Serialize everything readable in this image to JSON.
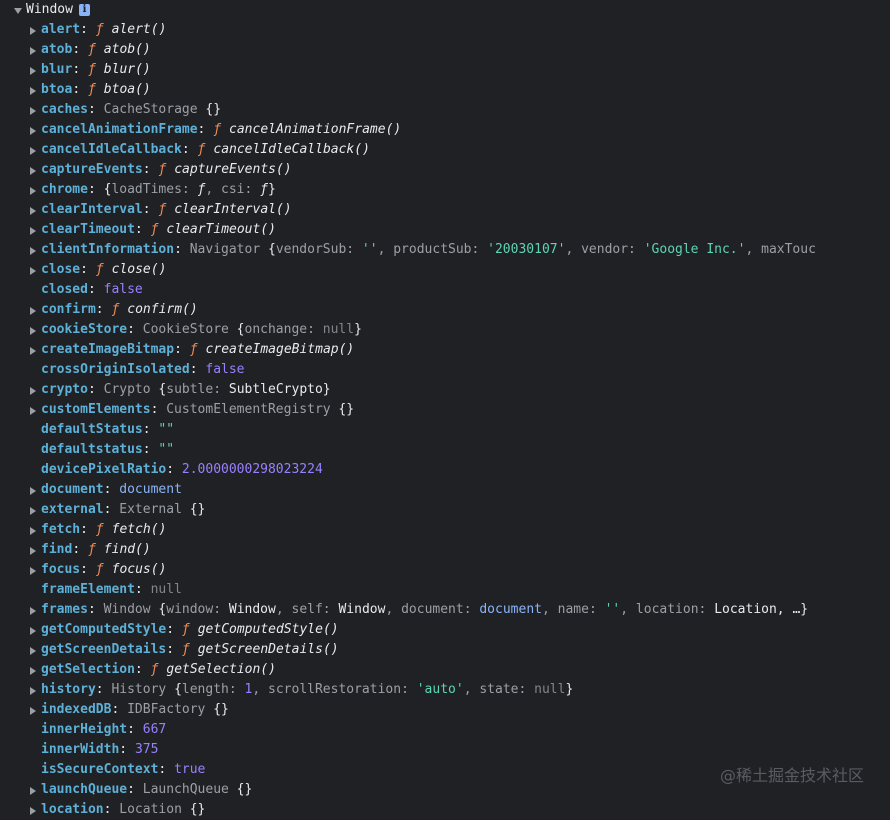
{
  "root": {
    "label": "Window",
    "info_icon": "info-icon"
  },
  "watermark": "@稀土掘金技术社区",
  "rows": [
    {
      "key": "alert",
      "expandable": true,
      "parts": [
        [
          "f",
          "ƒ"
        ],
        [
          "fn",
          "alert()"
        ]
      ]
    },
    {
      "key": "atob",
      "expandable": true,
      "parts": [
        [
          "f",
          "ƒ"
        ],
        [
          "fn",
          "atob()"
        ]
      ]
    },
    {
      "key": "blur",
      "expandable": true,
      "parts": [
        [
          "f",
          "ƒ"
        ],
        [
          "fn",
          "blur()"
        ]
      ]
    },
    {
      "key": "btoa",
      "expandable": true,
      "parts": [
        [
          "f",
          "ƒ"
        ],
        [
          "fn",
          "btoa()"
        ]
      ]
    },
    {
      "key": "caches",
      "expandable": true,
      "parts": [
        [
          "obj",
          "CacheStorage "
        ],
        [
          "plain",
          "{}"
        ]
      ]
    },
    {
      "key": "cancelAnimationFrame",
      "expandable": true,
      "parts": [
        [
          "f",
          "ƒ"
        ],
        [
          "fn",
          "cancelAnimationFrame()"
        ]
      ]
    },
    {
      "key": "cancelIdleCallback",
      "expandable": true,
      "parts": [
        [
          "f",
          "ƒ"
        ],
        [
          "fn",
          "cancelIdleCallback()"
        ]
      ]
    },
    {
      "key": "captureEvents",
      "expandable": true,
      "parts": [
        [
          "f",
          "ƒ"
        ],
        [
          "fn",
          "captureEvents()"
        ]
      ]
    },
    {
      "key": "chrome",
      "expandable": true,
      "parts": [
        [
          "plain",
          "{"
        ],
        [
          "obj",
          "loadTimes: "
        ],
        [
          "fn",
          "ƒ"
        ],
        [
          "obj",
          ", csi: "
        ],
        [
          "fn",
          "ƒ"
        ],
        [
          "plain",
          "}"
        ]
      ]
    },
    {
      "key": "clearInterval",
      "expandable": true,
      "parts": [
        [
          "f",
          "ƒ"
        ],
        [
          "fn",
          "clearInterval()"
        ]
      ]
    },
    {
      "key": "clearTimeout",
      "expandable": true,
      "parts": [
        [
          "f",
          "ƒ"
        ],
        [
          "fn",
          "clearTimeout()"
        ]
      ]
    },
    {
      "key": "clientInformation",
      "expandable": true,
      "parts": [
        [
          "obj",
          "Navigator "
        ],
        [
          "plain",
          "{"
        ],
        [
          "obj",
          "vendorSub: "
        ],
        [
          "str",
          "''"
        ],
        [
          "obj",
          ", productSub: "
        ],
        [
          "str",
          "'20030107'"
        ],
        [
          "obj",
          ", vendor: "
        ],
        [
          "str",
          "'Google Inc.'"
        ],
        [
          "obj",
          ", maxTouc"
        ]
      ]
    },
    {
      "key": "close",
      "expandable": true,
      "parts": [
        [
          "f",
          "ƒ"
        ],
        [
          "fn",
          "close()"
        ]
      ]
    },
    {
      "key": "closed",
      "expandable": false,
      "parts": [
        [
          "bool",
          "false"
        ]
      ]
    },
    {
      "key": "confirm",
      "expandable": true,
      "parts": [
        [
          "f",
          "ƒ"
        ],
        [
          "fn",
          "confirm()"
        ]
      ]
    },
    {
      "key": "cookieStore",
      "expandable": true,
      "parts": [
        [
          "obj",
          "CookieStore "
        ],
        [
          "plain",
          "{"
        ],
        [
          "obj",
          "onchange: "
        ],
        [
          "nul",
          "null"
        ],
        [
          "plain",
          "}"
        ]
      ]
    },
    {
      "key": "createImageBitmap",
      "expandable": true,
      "parts": [
        [
          "f",
          "ƒ"
        ],
        [
          "fn",
          "createImageBitmap()"
        ]
      ]
    },
    {
      "key": "crossOriginIsolated",
      "expandable": false,
      "parts": [
        [
          "bool",
          "false"
        ]
      ]
    },
    {
      "key": "crypto",
      "expandable": true,
      "parts": [
        [
          "obj",
          "Crypto "
        ],
        [
          "plain",
          "{"
        ],
        [
          "obj",
          "subtle: "
        ],
        [
          "plain",
          "SubtleCrypto}"
        ]
      ]
    },
    {
      "key": "customElements",
      "expandable": true,
      "parts": [
        [
          "obj",
          "CustomElementRegistry "
        ],
        [
          "plain",
          "{}"
        ]
      ]
    },
    {
      "key": "defaultStatus",
      "expandable": false,
      "parts": [
        [
          "str",
          "\"\""
        ]
      ]
    },
    {
      "key": "defaultstatus",
      "expandable": false,
      "parts": [
        [
          "str",
          "\"\""
        ]
      ]
    },
    {
      "key": "devicePixelRatio",
      "expandable": false,
      "parts": [
        [
          "num",
          "2.0000000298023224"
        ]
      ]
    },
    {
      "key": "document",
      "expandable": true,
      "parts": [
        [
          "link",
          "document"
        ]
      ]
    },
    {
      "key": "external",
      "expandable": true,
      "parts": [
        [
          "obj",
          "External "
        ],
        [
          "plain",
          "{}"
        ]
      ]
    },
    {
      "key": "fetch",
      "expandable": true,
      "parts": [
        [
          "f",
          "ƒ"
        ],
        [
          "fn",
          "fetch()"
        ]
      ]
    },
    {
      "key": "find",
      "expandable": true,
      "parts": [
        [
          "f",
          "ƒ"
        ],
        [
          "fn",
          "find()"
        ]
      ]
    },
    {
      "key": "focus",
      "expandable": true,
      "parts": [
        [
          "f",
          "ƒ"
        ],
        [
          "fn",
          "focus()"
        ]
      ]
    },
    {
      "key": "frameElement",
      "expandable": false,
      "parts": [
        [
          "nul",
          "null"
        ]
      ]
    },
    {
      "key": "frames",
      "expandable": true,
      "parts": [
        [
          "obj",
          "Window "
        ],
        [
          "plain",
          "{"
        ],
        [
          "obj",
          "window: "
        ],
        [
          "plain",
          "Window"
        ],
        [
          "obj",
          ", self: "
        ],
        [
          "plain",
          "Window"
        ],
        [
          "obj",
          ", document: "
        ],
        [
          "link",
          "document"
        ],
        [
          "obj",
          ", name: "
        ],
        [
          "str",
          "''"
        ],
        [
          "obj",
          ", location: "
        ],
        [
          "plain",
          "Location, …}"
        ]
      ]
    },
    {
      "key": "getComputedStyle",
      "expandable": true,
      "parts": [
        [
          "f",
          "ƒ"
        ],
        [
          "fn",
          "getComputedStyle()"
        ]
      ]
    },
    {
      "key": "getScreenDetails",
      "expandable": true,
      "parts": [
        [
          "f",
          "ƒ"
        ],
        [
          "fn",
          "getScreenDetails()"
        ]
      ]
    },
    {
      "key": "getSelection",
      "expandable": true,
      "parts": [
        [
          "f",
          "ƒ"
        ],
        [
          "fn",
          "getSelection()"
        ]
      ]
    },
    {
      "key": "history",
      "expandable": true,
      "parts": [
        [
          "obj",
          "History "
        ],
        [
          "plain",
          "{"
        ],
        [
          "obj",
          "length: "
        ],
        [
          "num",
          "1"
        ],
        [
          "obj",
          ", scrollRestoration: "
        ],
        [
          "str",
          "'auto'"
        ],
        [
          "obj",
          ", state: "
        ],
        [
          "nul",
          "null"
        ],
        [
          "plain",
          "}"
        ]
      ]
    },
    {
      "key": "indexedDB",
      "expandable": true,
      "parts": [
        [
          "obj",
          "IDBFactory "
        ],
        [
          "plain",
          "{}"
        ]
      ]
    },
    {
      "key": "innerHeight",
      "expandable": false,
      "parts": [
        [
          "num",
          "667"
        ]
      ]
    },
    {
      "key": "innerWidth",
      "expandable": false,
      "parts": [
        [
          "num",
          "375"
        ]
      ]
    },
    {
      "key": "isSecureContext",
      "expandable": false,
      "parts": [
        [
          "bool",
          "true"
        ]
      ]
    },
    {
      "key": "launchQueue",
      "expandable": true,
      "parts": [
        [
          "obj",
          "LaunchQueue "
        ],
        [
          "plain",
          "{}"
        ]
      ]
    },
    {
      "key": "location",
      "expandable": true,
      "parts": [
        [
          "obj",
          "Location "
        ],
        [
          "plain",
          "{}"
        ]
      ]
    }
  ]
}
